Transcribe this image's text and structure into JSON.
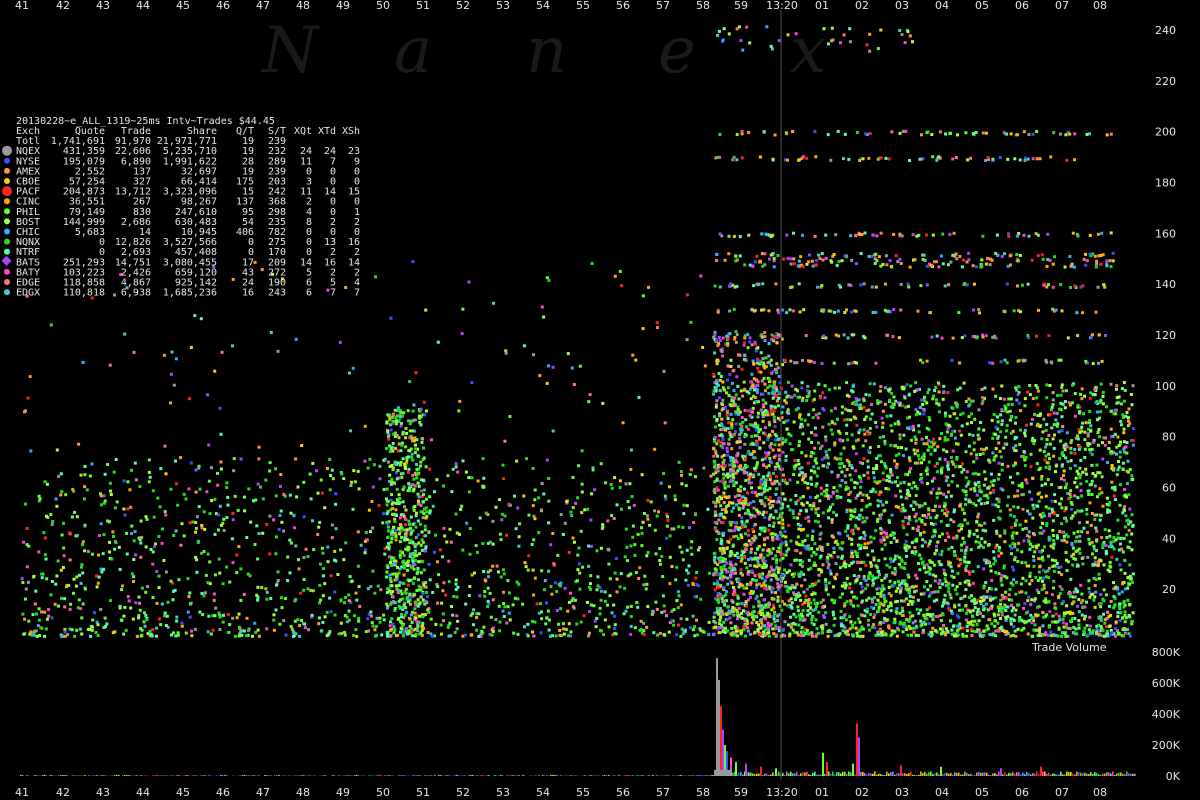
{
  "watermark": "Nanex",
  "chart_data": [
    {
      "type": "scatter",
      "title": "20130228~e_ALL_1319~25ms Intv~Trades $44.45",
      "x_ticks": [
        "41",
        "42",
        "43",
        "44",
        "45",
        "46",
        "47",
        "48",
        "49",
        "50",
        "51",
        "52",
        "53",
        "54",
        "55",
        "56",
        "57",
        "58",
        "59",
        "13:20",
        "01",
        "02",
        "03",
        "04",
        "05",
        "06",
        "07",
        "08"
      ],
      "y_ticks": [
        20,
        40,
        60,
        80,
        100,
        120,
        140,
        160,
        180,
        200,
        220,
        240
      ],
      "ylim": [
        0,
        245
      ],
      "grid": false,
      "series": [
        {
          "name": "NQEX",
          "color": "#9a9a9a"
        },
        {
          "name": "NYSE",
          "color": "#3355ff"
        },
        {
          "name": "AMEX",
          "color": "#ff9933"
        },
        {
          "name": "CBOE",
          "color": "#ffcc00"
        },
        {
          "name": "PACF",
          "color": "#ff2222"
        },
        {
          "name": "CINC",
          "color": "#ffaa00"
        },
        {
          "name": "PHIL",
          "color": "#66ff33"
        },
        {
          "name": "BOST",
          "color": "#aaff44"
        },
        {
          "name": "CHIC",
          "color": "#33aaff"
        },
        {
          "name": "NQNX",
          "color": "#22dd22"
        },
        {
          "name": "NTRF",
          "color": "#55ffaa"
        },
        {
          "name": "BATS",
          "color": "#aa44ff"
        },
        {
          "name": "BATY",
          "color": "#ff44cc"
        },
        {
          "name": "EDGE",
          "color": "#ff7777"
        },
        {
          "name": "EDGX",
          "color": "#44cccc"
        }
      ],
      "stats_table": {
        "header": [
          "Exch",
          "Quote",
          "Trade",
          "Share",
          "Q/T",
          "S/T",
          "XQt",
          "XTd",
          "XSh"
        ],
        "rows": [
          [
            "Totl",
            "1,741,691",
            "91,970",
            "21,971,771",
            "19",
            "239",
            "",
            "",
            ""
          ],
          [
            "NQEX",
            "431,359",
            "22,606",
            "5,235,710",
            "19",
            "232",
            "24",
            "24",
            "23"
          ],
          [
            "NYSE",
            "195,079",
            "6,890",
            "1,991,622",
            "28",
            "289",
            "11",
            "7",
            "9"
          ],
          [
            "AMEX",
            "2,552",
            "137",
            "32,697",
            "19",
            "239",
            "0",
            "0",
            "0"
          ],
          [
            "CBOE",
            "57,254",
            "327",
            "66,414",
            "175",
            "203",
            "3",
            "0",
            "0"
          ],
          [
            "PACF",
            "204,873",
            "13,712",
            "3,323,096",
            "15",
            "242",
            "11",
            "14",
            "15"
          ],
          [
            "CINC",
            "36,551",
            "267",
            "98,267",
            "137",
            "368",
            "2",
            "0",
            "0"
          ],
          [
            "PHIL",
            "79,149",
            "830",
            "247,610",
            "95",
            "298",
            "4",
            "0",
            "1"
          ],
          [
            "BOST",
            "144,999",
            "2,686",
            "630,483",
            "54",
            "235",
            "8",
            "2",
            "2"
          ],
          [
            "CHIC",
            "5,683",
            "14",
            "10,945",
            "406",
            "782",
            "0",
            "0",
            "0"
          ],
          [
            "NQNX",
            "0",
            "12,826",
            "3,527,566",
            "0",
            "275",
            "0",
            "13",
            "16"
          ],
          [
            "NTRF",
            "0",
            "2,693",
            "457,408",
            "0",
            "170",
            "0",
            "2",
            "2"
          ],
          [
            "BATS",
            "251,293",
            "14,751",
            "3,080,455",
            "17",
            "209",
            "14",
            "16",
            "14"
          ],
          [
            "BATY",
            "103,223",
            "2,426",
            "659,120",
            "43",
            "272",
            "5",
            "2",
            "2"
          ],
          [
            "EDGE",
            "118,858",
            "4,867",
            "925,142",
            "24",
            "190",
            "6",
            "5",
            "4"
          ],
          [
            "EDGX",
            "110,818",
            "6,938",
            "1,685,236",
            "16",
            "243",
            "6",
            "7",
            "7"
          ]
        ]
      }
    },
    {
      "type": "bar",
      "title": "Trade Volume",
      "y_ticks": [
        "800K",
        "600K",
        "400K",
        "200K",
        "0K"
      ],
      "ylim": [
        0,
        800000
      ],
      "peaks": [
        {
          "x_tick": "58",
          "value": 760000,
          "color": "#9a9a9a"
        },
        {
          "x_tick": "59",
          "value": 340000,
          "color": "#aa44ff"
        },
        {
          "x_tick": "02",
          "value": 340000,
          "color": "#ff2222"
        },
        {
          "x_tick": "01",
          "value": 150000,
          "color": "#66ff33"
        }
      ]
    }
  ]
}
